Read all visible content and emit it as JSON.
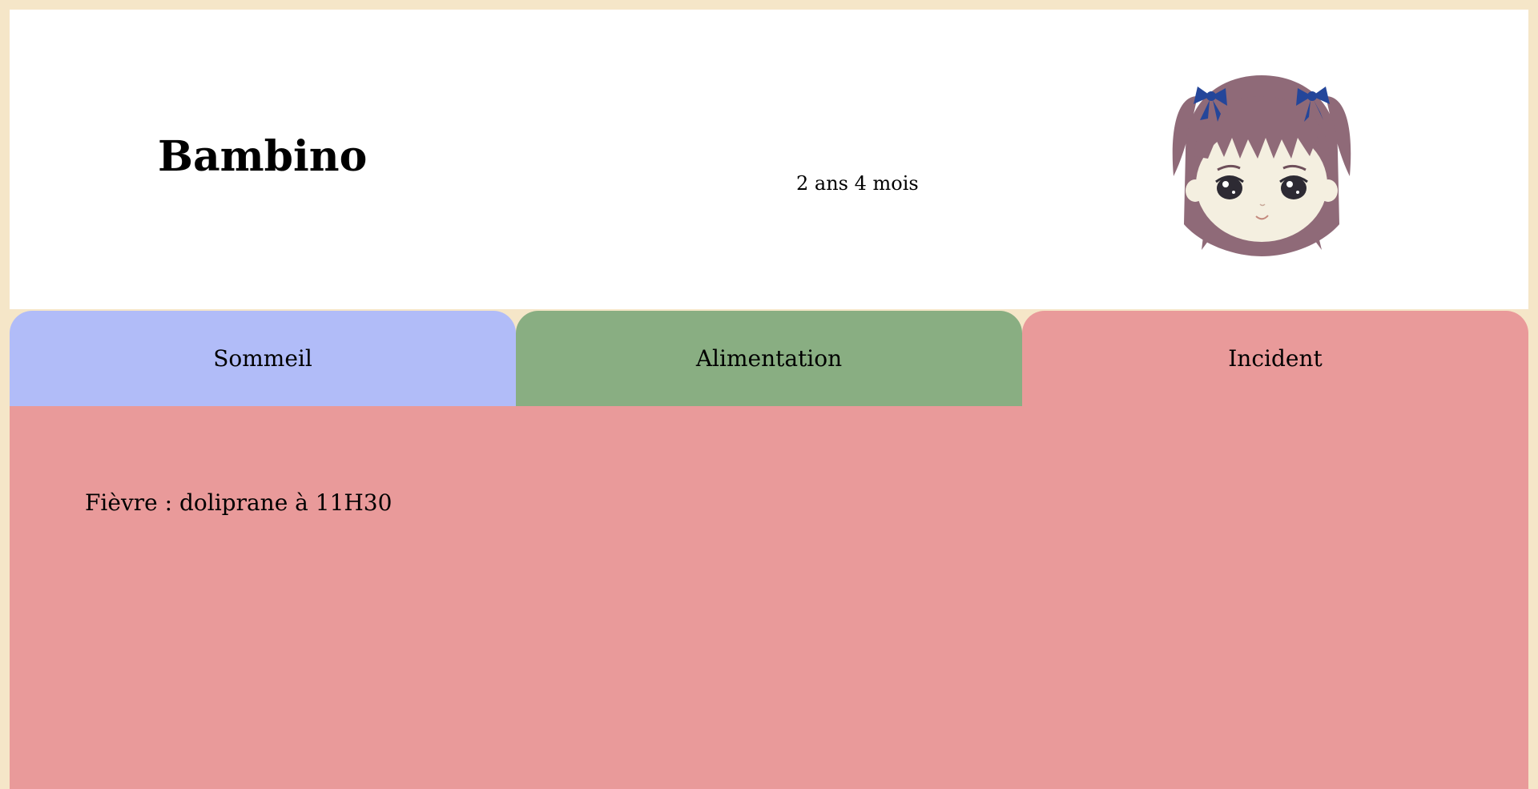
{
  "colors": {
    "page_background": "#f5e6c8",
    "header_background": "#ffffff",
    "tab_sleep": "#b1bcf8",
    "tab_food": "#89ae82",
    "tab_incident": "#e99a9a",
    "panel_background": "#e99a9a"
  },
  "header": {
    "name": "Bambino",
    "age": "2 ans 4 mois",
    "avatar_icon": "girl-avatar-icon"
  },
  "tabs": [
    {
      "label": "Sommeil",
      "color": "#b1bcf8"
    },
    {
      "label": "Alimentation",
      "color": "#89ae82"
    },
    {
      "label": "Incident",
      "color": "#e99a9a",
      "active": true
    }
  ],
  "panel": {
    "entry": "Fièvre : doliprane à 11H30"
  }
}
